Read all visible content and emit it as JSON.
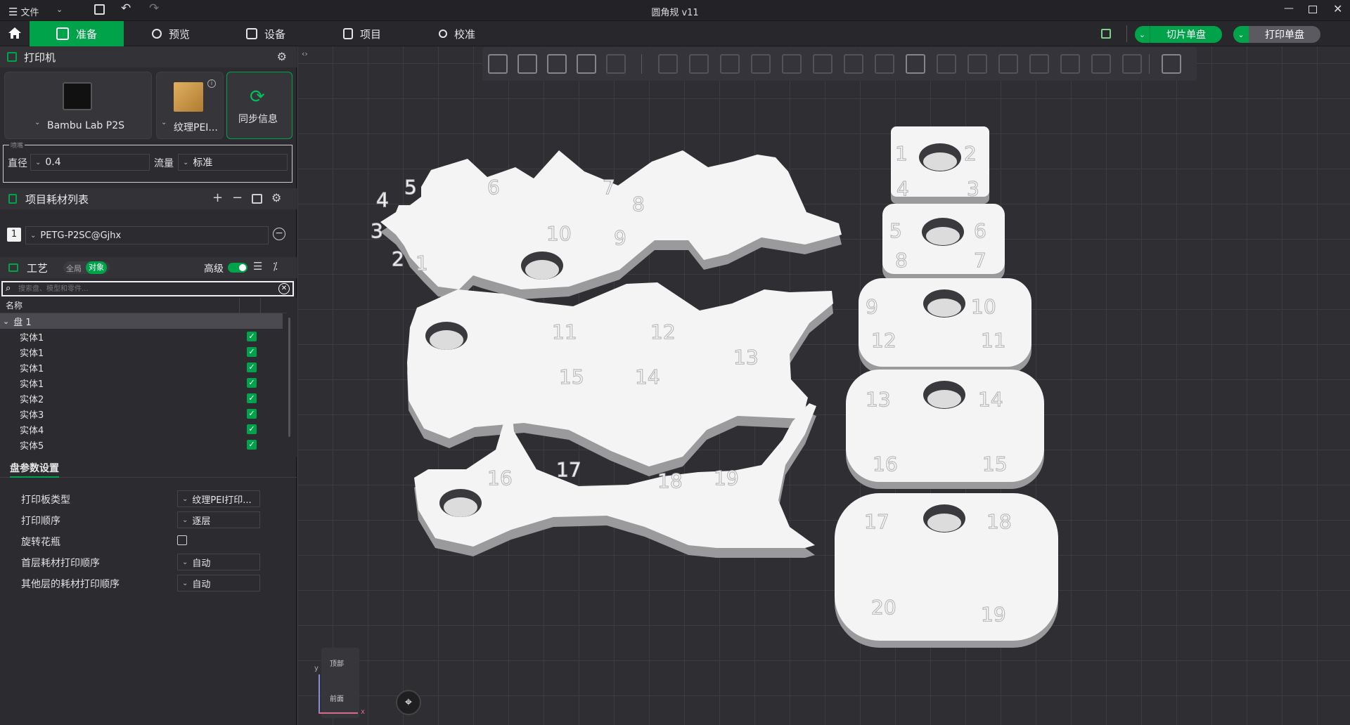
{
  "window": {
    "title": "圆角规 v11",
    "menu_label": "文件"
  },
  "tabs": [
    {
      "label": "准备",
      "active": true
    },
    {
      "label": "预览"
    },
    {
      "label": "设备"
    },
    {
      "label": "项目"
    },
    {
      "label": "校准"
    }
  ],
  "actions": {
    "slice_label": "切片单盘",
    "print_label": "打印单盘"
  },
  "printer": {
    "section_title": "打印机",
    "model": "Bambu Lab P2S",
    "plate": "纹理PEI...",
    "sync_label": "同步信息",
    "nozzle_group_label": "喷嘴",
    "diameter_label": "直径",
    "diameter_value": "0.4",
    "flow_label": "流量",
    "flow_value": "标准"
  },
  "filament": {
    "section_title": "项目耗材列表",
    "slot": "1",
    "name": "PETG-P2SC@Gjhx"
  },
  "process": {
    "section_title": "工艺",
    "global_label": "全局",
    "object_label": "对象",
    "advanced_label": "高级",
    "search_placeholder": "搜索盘、模型和零件..."
  },
  "object_list": {
    "header": "名称",
    "plate": "盘 1",
    "items": [
      "实体1",
      "实体1",
      "实体1",
      "实体1",
      "实体2",
      "实体3",
      "实体4",
      "实体5"
    ]
  },
  "plate_settings": {
    "tab_label": "盘参数设置",
    "rows": [
      {
        "label": "打印板类型",
        "value": "纹理PEI打印...",
        "kind": "select"
      },
      {
        "label": "打印顺序",
        "value": "逐层",
        "kind": "select"
      },
      {
        "label": "旋转花瓶",
        "value": "",
        "kind": "checkbox"
      },
      {
        "label": "首层耗材打印顺序",
        "value": "自动",
        "kind": "select"
      },
      {
        "label": "其他层的耗材打印顺序",
        "value": "自动",
        "kind": "select"
      }
    ]
  },
  "view_cube": {
    "top": "顶部",
    "front": "前面",
    "axis_x": "x",
    "axis_y": "y"
  },
  "model_labels": {
    "piece1": [
      "4",
      "5",
      "6",
      "7",
      "8",
      "3",
      "10",
      "9",
      "2",
      "1"
    ],
    "piece2": [
      "11",
      "12",
      "13",
      "15",
      "14"
    ],
    "piece3": [
      "16",
      "17",
      "18",
      "19"
    ],
    "tag1": [
      "1",
      "2",
      "4",
      "3"
    ],
    "tag2": [
      "5",
      "6",
      "8",
      "7"
    ],
    "tag3": [
      "9",
      "10",
      "12",
      "11"
    ],
    "tag4": [
      "13",
      "14",
      "16",
      "15"
    ],
    "tag5": [
      "17",
      "18",
      "20",
      "19"
    ]
  },
  "colors": {
    "accent": "#00a34a",
    "model": "#f4f4f4",
    "canvas": "#2f2f33"
  }
}
